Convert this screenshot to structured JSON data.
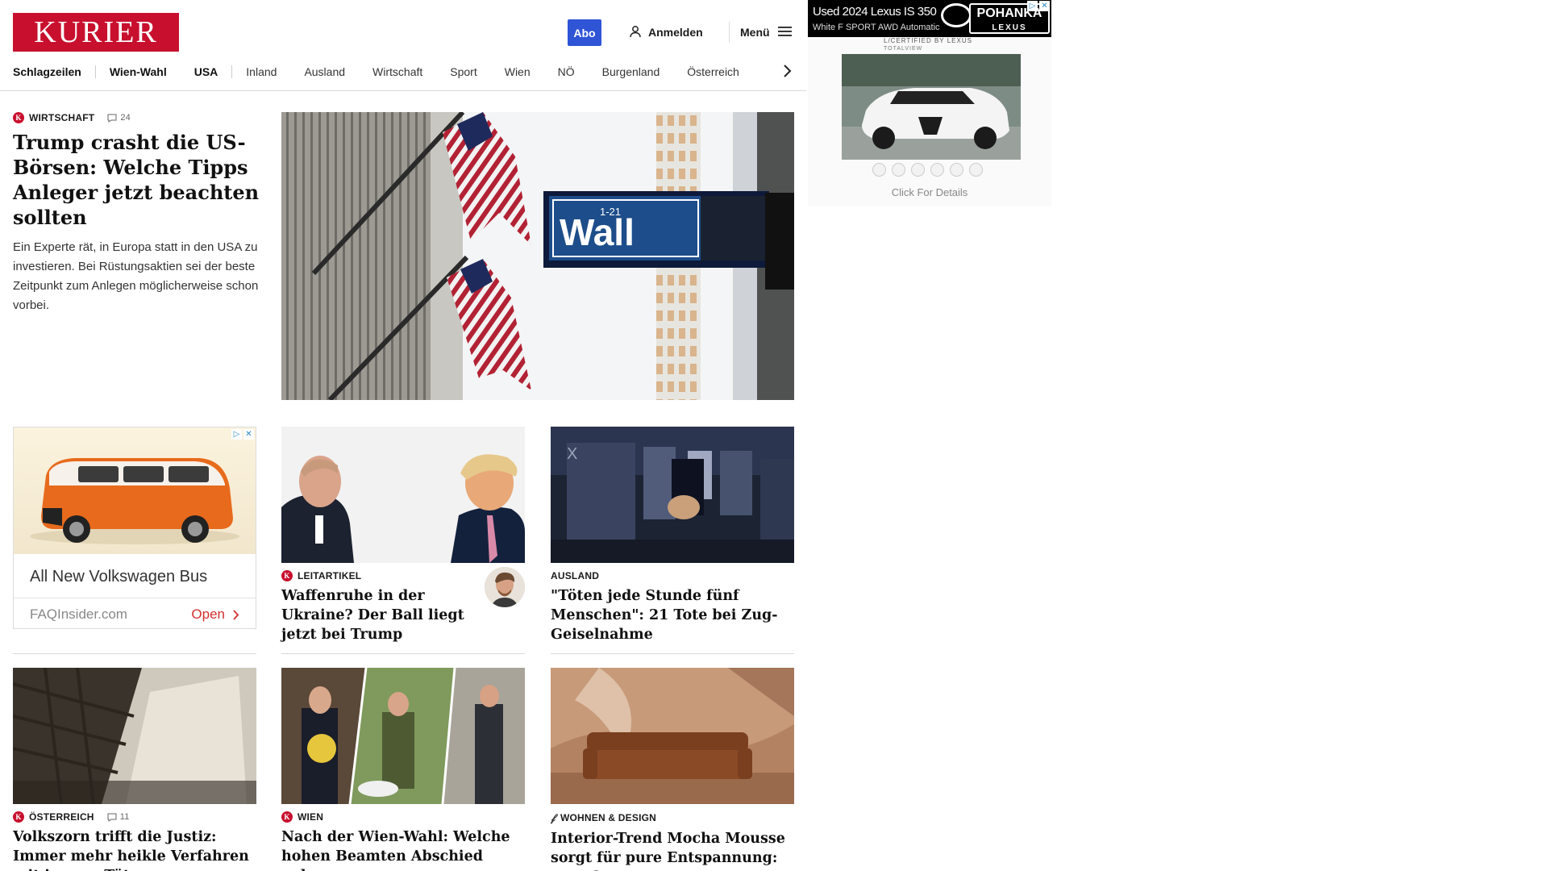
{
  "header": {
    "logo": "KURIER",
    "abo_label": "Abo",
    "login_label": "Anmelden",
    "menu_label": "Menü"
  },
  "nav": {
    "items": [
      "Schlagzeilen",
      "Wien-Wahl",
      "USA",
      "Inland",
      "Ausland",
      "Wirtschaft",
      "Sport",
      "Wien",
      "NÖ",
      "Burgenland",
      "Österreich"
    ]
  },
  "lead": {
    "section": "WIRTSCHAFT",
    "comments": "24",
    "title": "Trump crasht die US-Börsen: Welche Tipps Anleger jetzt beachten sollten",
    "teaser": "Ein Experte rät, in Europa statt in den USA zu investieren. Bei Rüstungsaktien sei der beste Zeitpunkt zum Anlegen möglicherweise schon vorbei.",
    "image_icon": "wall-street-sign-photo",
    "sign_text": "Wall",
    "sign_small": "1-21"
  },
  "ad_left": {
    "headline": "All New Volkswagen Bus",
    "source": "FAQInsider.com",
    "cta": "Open"
  },
  "cards_row1": [
    {
      "section": "LEITARTIKEL",
      "title": "Waffenruhe in der Ukraine? Der Ball liegt jetzt bei Trump",
      "badge": true
    },
    {
      "section": "AUSLAND",
      "title": "\"Töten jede Stunde fünf Menschen\": 21 Tote bei Zug-Geiselnahme",
      "badge": false
    }
  ],
  "cards_row2": [
    {
      "section": "ÖSTERREICH",
      "comments": "11",
      "title": "Volkszorn trifft die Justiz: Immer mehr heikle Verfahren mit jungen Tätern"
    },
    {
      "section": "WIEN",
      "title": "Nach der Wien-Wahl: Welche hohen Beamten Abschied nehmen"
    },
    {
      "section": "WOHNEN & DESIGN",
      "title": "Interior-Trend Mocha Mousse sorgt für pure Entspannung: So geht's"
    }
  ],
  "side_ad": {
    "line1": "Used 2024 Lexus IS 350",
    "line2": "White F SPORT AWD Automatic",
    "brand": "POHANKA",
    "brand_sub": "LEXUS",
    "certified": "L/CERTIFIED BY LEXUS",
    "certified2": "TOTALVIEW",
    "cta": "Click For Details"
  },
  "colors": {
    "brand_red": "#c8102e",
    "abo_blue": "#2f54d6",
    "ad_red": "#d32f2f"
  }
}
